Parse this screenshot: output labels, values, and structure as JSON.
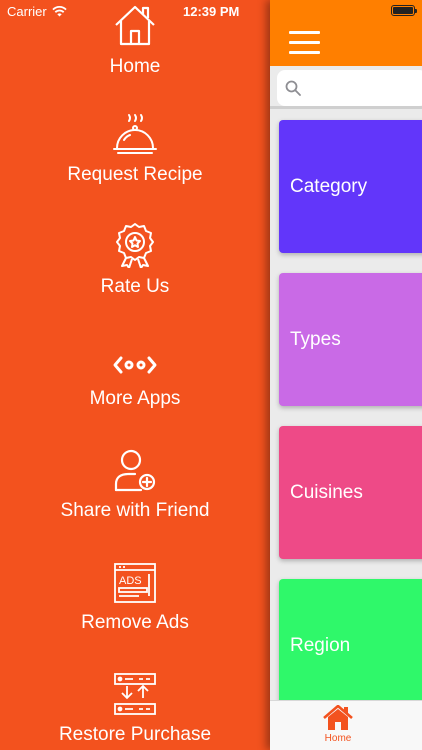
{
  "status_bar": {
    "carrier": "Carrier",
    "time": "12:39 PM"
  },
  "drawer": {
    "background_color": "#F3521E",
    "items": [
      {
        "label": "Home",
        "icon": "home-icon"
      },
      {
        "label": "Request Recipe",
        "icon": "cloche-icon"
      },
      {
        "label": "Rate Us",
        "icon": "award-ribbon-icon"
      },
      {
        "label": "More Apps",
        "icon": "more-apps-code-icon"
      },
      {
        "label": "Share with Friend",
        "icon": "add-user-icon"
      },
      {
        "label": "Remove Ads",
        "icon": "ads-icon"
      },
      {
        "label": "Restore Purchase",
        "icon": "restore-servers-icon"
      }
    ]
  },
  "main": {
    "nav_color": "#FF7F00",
    "search": {
      "placeholder": ""
    },
    "cards": [
      {
        "label": "Category",
        "color": "#6236FA"
      },
      {
        "label": "Types",
        "color": "#C96AE6"
      },
      {
        "label": "Cuisines",
        "color": "#EE4A87"
      },
      {
        "label": "Region",
        "color": "#2FF86A"
      }
    ],
    "tab_bar": {
      "home_label": "Home",
      "home_icon": "home-filled-icon",
      "active_color": "#F3521E"
    }
  }
}
